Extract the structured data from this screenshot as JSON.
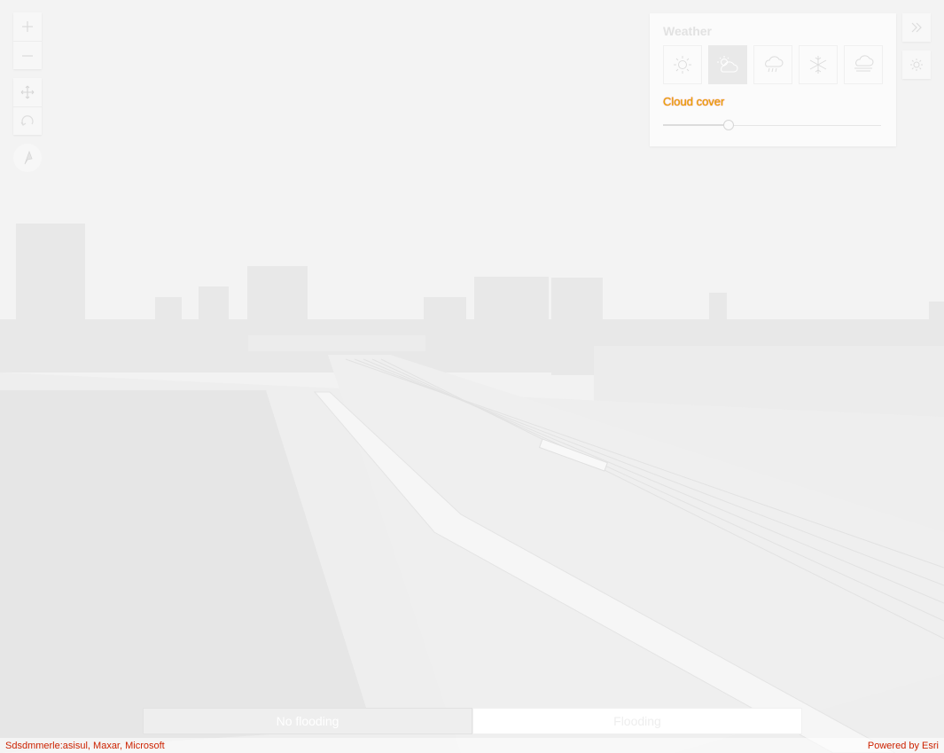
{
  "map_controls": {
    "zoom_in_icon": "plus-icon",
    "zoom_out_icon": "minus-icon",
    "pan_icon": "move-arrows-icon",
    "rotate_icon": "rotate-icon",
    "compass_icon": "compass-icon"
  },
  "weather": {
    "title": "Weather",
    "options": [
      {
        "name": "sunny",
        "icon": "sun-icon",
        "active": false
      },
      {
        "name": "cloudy",
        "icon": "cloud-sun-icon",
        "active": true
      },
      {
        "name": "rainy",
        "icon": "rain-cloud-icon",
        "active": false
      },
      {
        "name": "snowy",
        "icon": "snowflake-icon",
        "active": false
      },
      {
        "name": "foggy",
        "icon": "fog-cloud-icon",
        "active": false
      }
    ],
    "slider_label": "Cloud cover",
    "slider_value": 0.3
  },
  "side_buttons": {
    "expand_icon": "double-chevron-right-icon",
    "daylight_icon": "sun-icon"
  },
  "flood_toggle": {
    "option_off": "No flooding",
    "option_on": "Flooding",
    "selected": "No flooding"
  },
  "attribution": {
    "left": "Sdsdmmerle:asisul, Maxar, Microsoft",
    "right": "Powered by Esri"
  },
  "colors": {
    "accent": "#e0b000",
    "panel_bg": "#fbfbfb",
    "selected_weather_bg": "#e9e9e9"
  }
}
